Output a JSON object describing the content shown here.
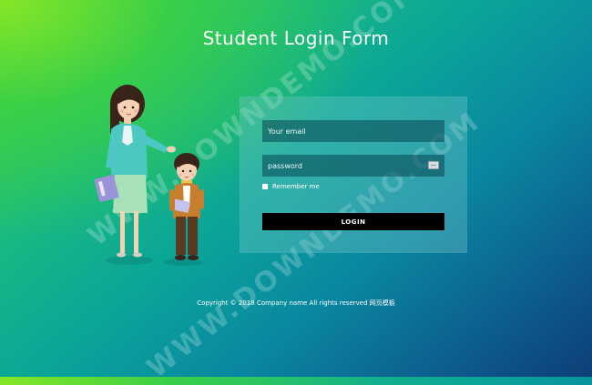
{
  "header": {
    "title": "Student Login Form"
  },
  "form": {
    "email_placeholder": "Your email",
    "password_placeholder": "password",
    "remember_label": "Remember me",
    "login_label": "LOGIN"
  },
  "footer": {
    "copyright": "Copyright © 2018 Company name All rights reserved 网页模板"
  },
  "watermark": {
    "text": "WWW.DOWNDEMO.COM"
  },
  "colors": {
    "button_bg": "#000000",
    "text": "#ffffff"
  }
}
